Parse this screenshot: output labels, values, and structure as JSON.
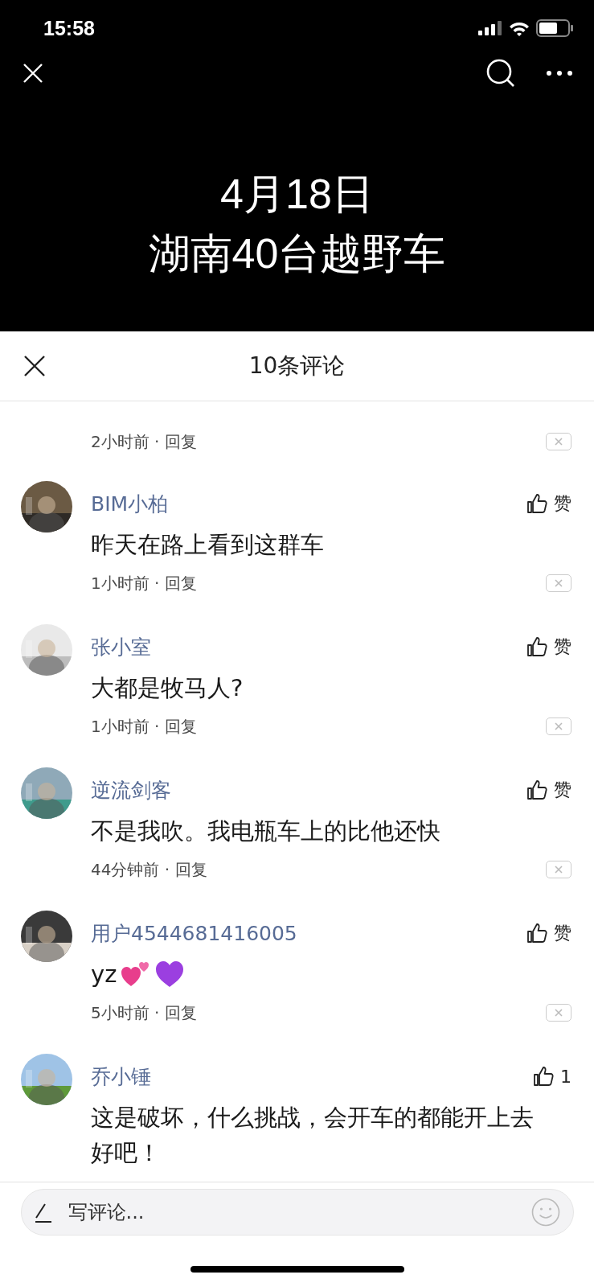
{
  "status_bar": {
    "time": "15:58"
  },
  "video": {
    "caption": [
      "4月18日",
      "湖南40台越野车"
    ]
  },
  "sheet": {
    "title": "10条评论"
  },
  "comments": [
    {
      "kind": "partial",
      "time": "2小时前",
      "sep": "·",
      "reply": "回复"
    },
    {
      "kind": "full",
      "name": "BIM小柏",
      "body": "昨天在路上看到这群车",
      "time": "1小时前",
      "sep": "·",
      "reply": "回复",
      "like": "赞"
    },
    {
      "kind": "full",
      "name": "张小室",
      "body": "大都是牧马人?",
      "time": "1小时前",
      "sep": "·",
      "reply": "回复",
      "like": "赞"
    },
    {
      "kind": "full",
      "name": "逆流剑客",
      "body": "不是我吹。我电瓶车上的比他还快",
      "time": "44分钟前",
      "sep": "·",
      "reply": "回复",
      "like": "赞"
    },
    {
      "kind": "full",
      "name": "用户4544681416005",
      "body": "yz",
      "emoji": [
        {
          "kind": "two_hearts"
        },
        {
          "kind": "purple_heart"
        }
      ],
      "time": "5小时前",
      "sep": "·",
      "reply": "回复",
      "like": "赞"
    },
    {
      "kind": "full",
      "name": "乔小锤",
      "body": "这是破坏，什么挑战，会开车的都能开上去好吧！",
      "like": "1"
    }
  ],
  "composer": {
    "placeholder": "写评论..."
  }
}
